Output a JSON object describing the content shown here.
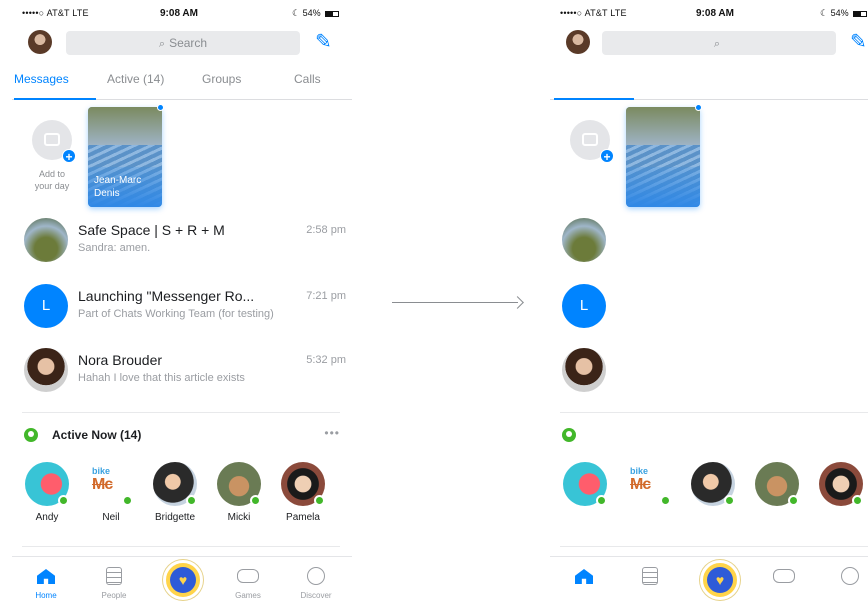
{
  "status_bar": {
    "carrier": "•••••○ AT&T  LTE",
    "time": "9:08 AM",
    "battery": "54%",
    "moon": "☾"
  },
  "header": {
    "search_placeholder": "Search",
    "search_icon": "search-icon",
    "compose_icon": "compose-icon"
  },
  "tabs": [
    {
      "label": "Messages",
      "active": true
    },
    {
      "label": "Active (14)",
      "active": false
    },
    {
      "label": "Groups",
      "active": false
    },
    {
      "label": "Calls",
      "active": false
    }
  ],
  "stories": {
    "add_label_line1": "Add to",
    "add_label_line2": "your day",
    "story_name_line1": "Jean-Marc",
    "story_name_line2": "Denis"
  },
  "conversations": [
    {
      "title": "Safe Space | S + R + M",
      "subtitle": "Sandra: amen.",
      "time": "2:58 pm",
      "avatar_letter": ""
    },
    {
      "title": "Launching \"Messenger Ro...",
      "subtitle": "Part of Chats Working Team (for testing)",
      "time": "7:21 pm",
      "avatar_letter": "L"
    },
    {
      "title": "Nora Brouder",
      "subtitle": "Hahah I love that this article exists",
      "time": "5:32 pm",
      "avatar_letter": ""
    }
  ],
  "active_now": {
    "label": "Active Now (14)",
    "more": "•••",
    "people": [
      {
        "name": "Andy"
      },
      {
        "name": "Neil",
        "logo_top": "bike",
        "logo_mid": "Mc"
      },
      {
        "name": "Bridgette"
      },
      {
        "name": "Micki"
      },
      {
        "name": "Pamela"
      }
    ]
  },
  "bottom_nav": [
    {
      "label": "Home",
      "icon": "home-icon",
      "active": true
    },
    {
      "label": "People",
      "icon": "people-list-icon",
      "active": false
    },
    {
      "label": "",
      "icon": "heart-icon",
      "active": false
    },
    {
      "label": "Games",
      "icon": "gamepad-icon",
      "active": false
    },
    {
      "label": "Discover",
      "icon": "discover-icon",
      "active": false
    }
  ],
  "colors": {
    "accent": "#0084ff",
    "active_green": "#42b72a",
    "heart_yellow": "#ffd44a",
    "heart_blue": "#2e5bd8"
  }
}
